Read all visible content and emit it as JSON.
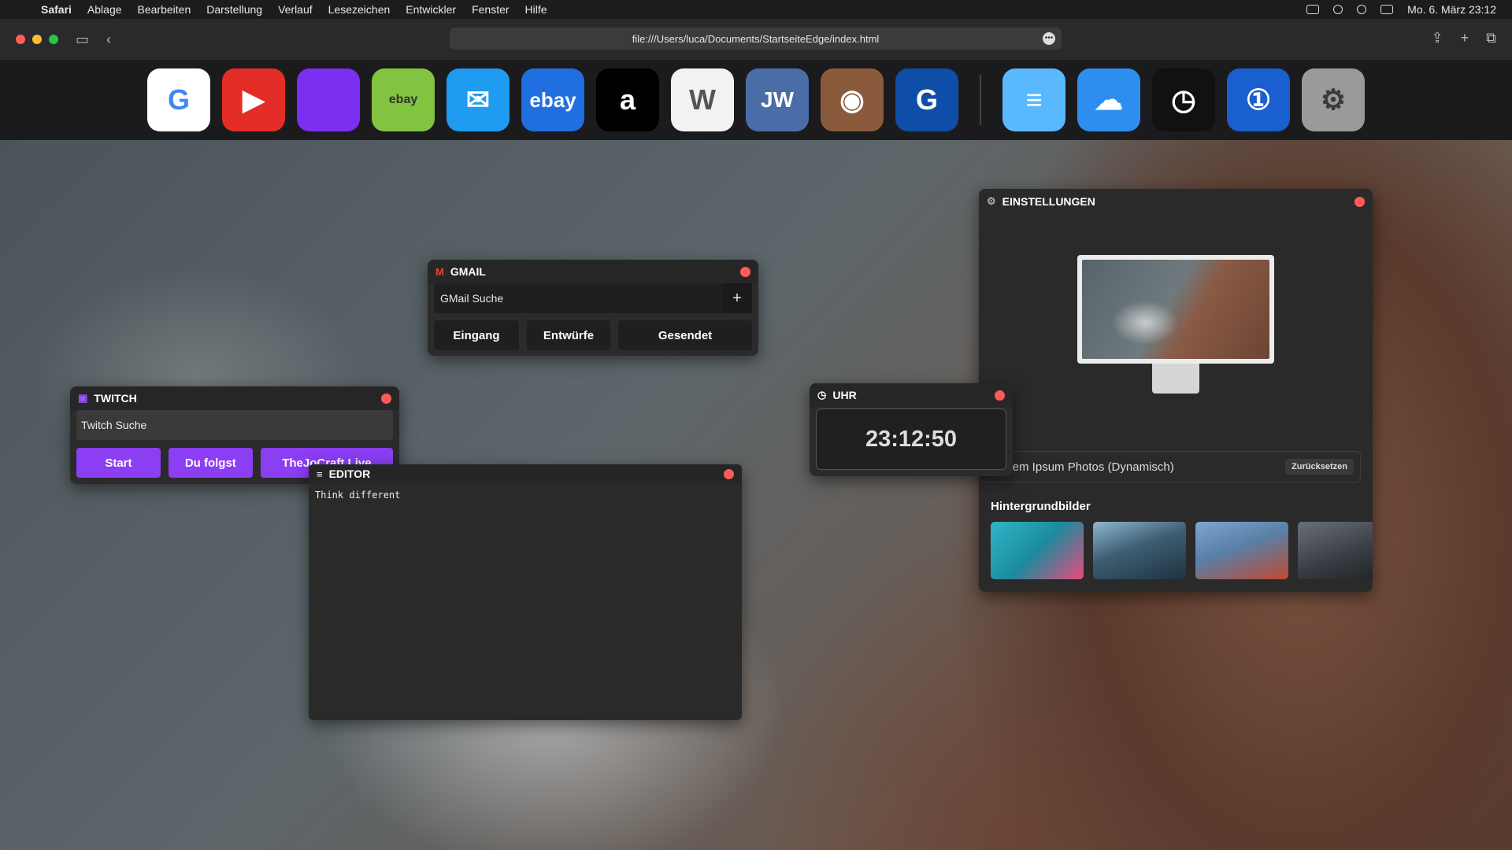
{
  "menubar": {
    "apple": "",
    "items": [
      "Safari",
      "Ablage",
      "Bearbeiten",
      "Darstellung",
      "Verlauf",
      "Lesezeichen",
      "Entwickler",
      "Fenster",
      "Hilfe"
    ],
    "datetime": "Mo. 6. März 23:12"
  },
  "toolbar": {
    "url": "file:///Users/luca/Documents/StartseiteEdge/index.html",
    "more": "•••"
  },
  "dock": {
    "apps": [
      {
        "name": "Google",
        "glyph": "G",
        "bg": "#ffffff",
        "fg": "#4285f4"
      },
      {
        "name": "YouTube",
        "glyph": "▶",
        "bg": "#e52d27",
        "fg": "#ffffff"
      },
      {
        "name": "Twitch",
        "glyph": "",
        "bg": "#7b2ff0",
        "fg": "#ffffff"
      },
      {
        "name": "eBay Kleinanzeigen",
        "glyph": "ebay",
        "bg": "#82c341",
        "fg": "#333333"
      },
      {
        "name": "Mail",
        "glyph": "✉",
        "bg": "#1f9bf0",
        "fg": "#ffffff"
      },
      {
        "name": "eBay",
        "glyph": "ebay",
        "bg": "#1f6fe0",
        "fg": "#ffffff"
      },
      {
        "name": "Amazon",
        "glyph": "a",
        "bg": "#000000",
        "fg": "#ffffff"
      },
      {
        "name": "Wikipedia",
        "glyph": "W",
        "bg": "#f2f2f2",
        "fg": "#555555"
      },
      {
        "name": "JW.ORG",
        "glyph": "JW",
        "bg": "#4a6da7",
        "fg": "#ffffff"
      },
      {
        "name": "Instagram",
        "glyph": "◉",
        "bg": "#8a5a3c",
        "fg": "#ffffff"
      },
      {
        "name": "G",
        "glyph": "G",
        "bg": "#0f4ea8",
        "fg": "#ffffff"
      },
      {
        "name": "Notes",
        "glyph": "≡",
        "bg": "#5ab8ff",
        "fg": "#ffffff"
      },
      {
        "name": "Weather",
        "glyph": "☁",
        "bg": "#2d8ef0",
        "fg": "#ffffff"
      },
      {
        "name": "Clock",
        "glyph": "◷",
        "bg": "#111111",
        "fg": "#ffffff"
      },
      {
        "name": "1Password",
        "glyph": "①",
        "bg": "#1a5fcf",
        "fg": "#ffffff"
      },
      {
        "name": "Settings",
        "glyph": "⚙",
        "bg": "#9a9a9a",
        "fg": "#3a3a3a"
      }
    ]
  },
  "gmail": {
    "title": "GMAIL",
    "search_placeholder": "GMail Suche",
    "add": "+",
    "buttons": [
      "Eingang",
      "Entwürfe",
      "Gesendet"
    ]
  },
  "twitch": {
    "title": "TWITCH",
    "search_placeholder": "Twitch Suche",
    "buttons": [
      "Start",
      "Du folgst",
      "TheJoCraft Live"
    ]
  },
  "editor": {
    "title": "EDITOR",
    "text": "Think different"
  },
  "uhr": {
    "title": "UHR",
    "time": "23:12:50"
  },
  "settings": {
    "title": "EINSTELLUNGEN",
    "wallpaper_mode": "Lorem Ipsum Photos (Dynamisch)",
    "reset_label": "Zurücksetzen",
    "backgrounds_title": "Hintergrundbilder"
  },
  "colors": {
    "accent_twitch": "#8b3ef2",
    "close": "#ff5b56",
    "widget_bg": "#2b2b2c"
  }
}
